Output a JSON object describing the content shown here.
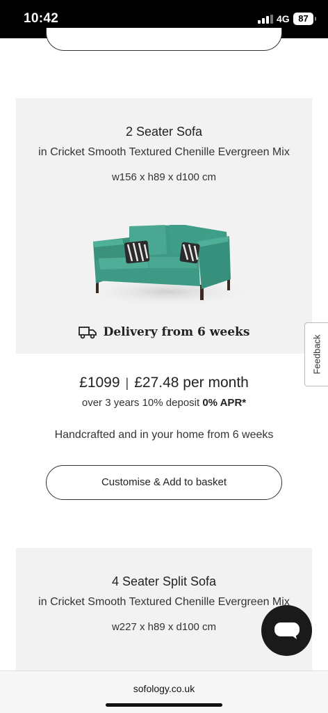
{
  "status_bar": {
    "time": "10:42",
    "network": "4G",
    "battery": "87"
  },
  "product_1": {
    "title": "2 Seater Sofa",
    "fabric": "in Cricket Smooth Textured Chenille Evergreen Mix",
    "dimensions": "w156 x h89 x d100 cm",
    "delivery": "Delivery from 6 weeks",
    "price": "£1099",
    "monthly": "£27.48 per month",
    "finance_prefix": "over 3 years 10% deposit",
    "finance_apr": "0% APR*",
    "handcrafted": "Handcrafted and in your home from 6 weeks",
    "cta_label": "Customise & Add to basket"
  },
  "product_2": {
    "title": "4 Seater Split Sofa",
    "fabric": "in Cricket Smooth Textured Chenille Evergreen Mix",
    "dimensions": "w227 x h89 x d100 cm"
  },
  "feedback_label": "Feedback",
  "browser": {
    "url": "sofology.co.uk"
  },
  "colors": {
    "sofa": "#3e9a85",
    "card_bg": "#f2f2f2",
    "chat_bg": "#1a1a1a"
  },
  "icons": [
    "truck-icon",
    "chat-icon",
    "signal-icon",
    "battery-icon"
  ]
}
